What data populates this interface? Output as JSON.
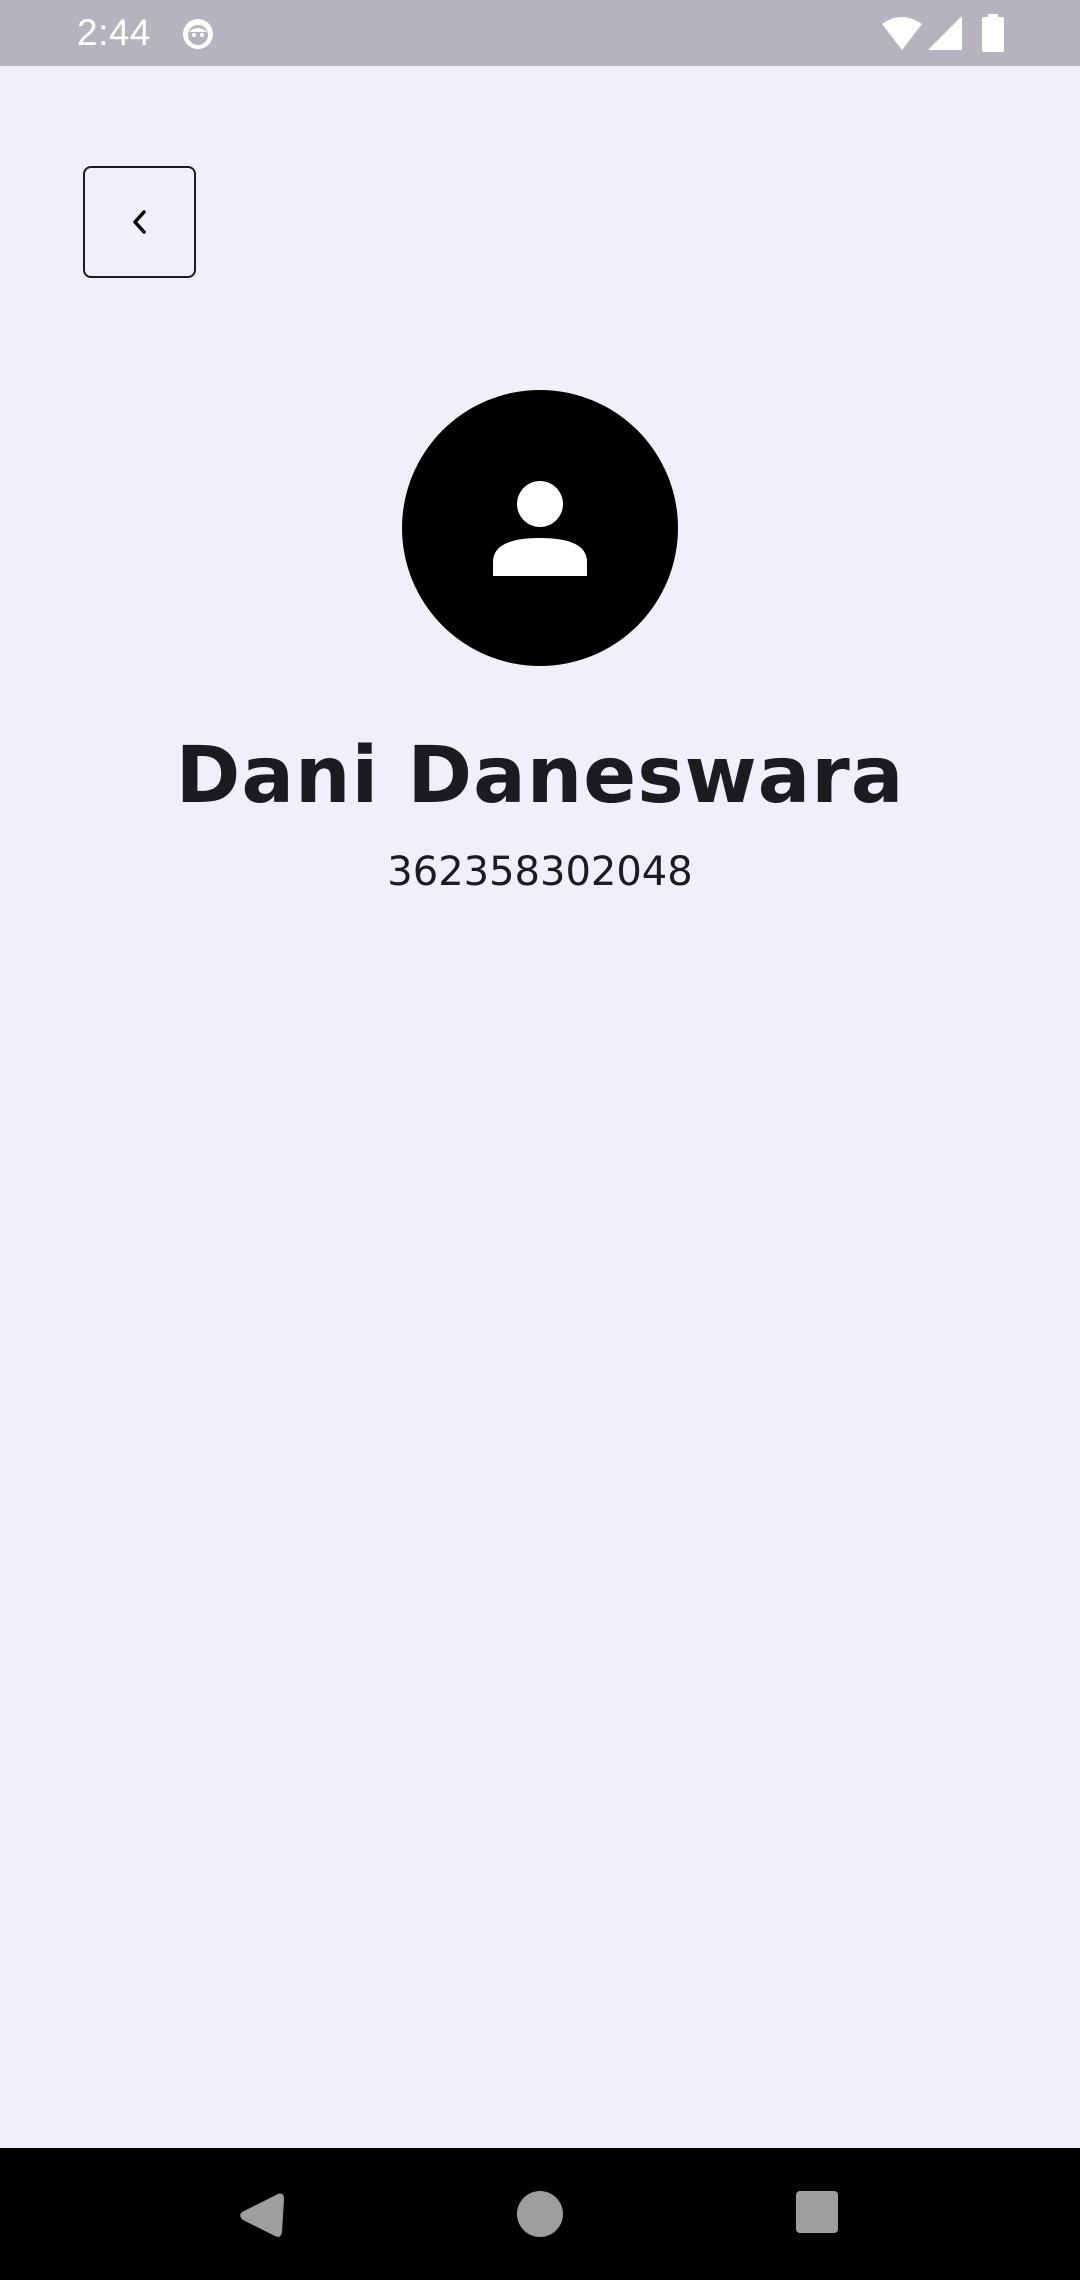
{
  "status_bar": {
    "time": "2:44",
    "icons": [
      "app-notification-icon",
      "wifi-icon",
      "signal-icon",
      "battery-icon"
    ],
    "background": "#b6b3bf"
  },
  "header": {
    "back_icon": "chevron-left-icon"
  },
  "profile": {
    "avatar_icon": "person-icon",
    "name": "Dani Daneswara",
    "phone": "362358302048"
  },
  "navigation_bar": {
    "icons": [
      "nav-back-icon",
      "nav-home-icon",
      "nav-recents-icon"
    ]
  },
  "colors": {
    "background": "#f2effd",
    "text": "#1d1b20",
    "avatar": "#000000"
  }
}
